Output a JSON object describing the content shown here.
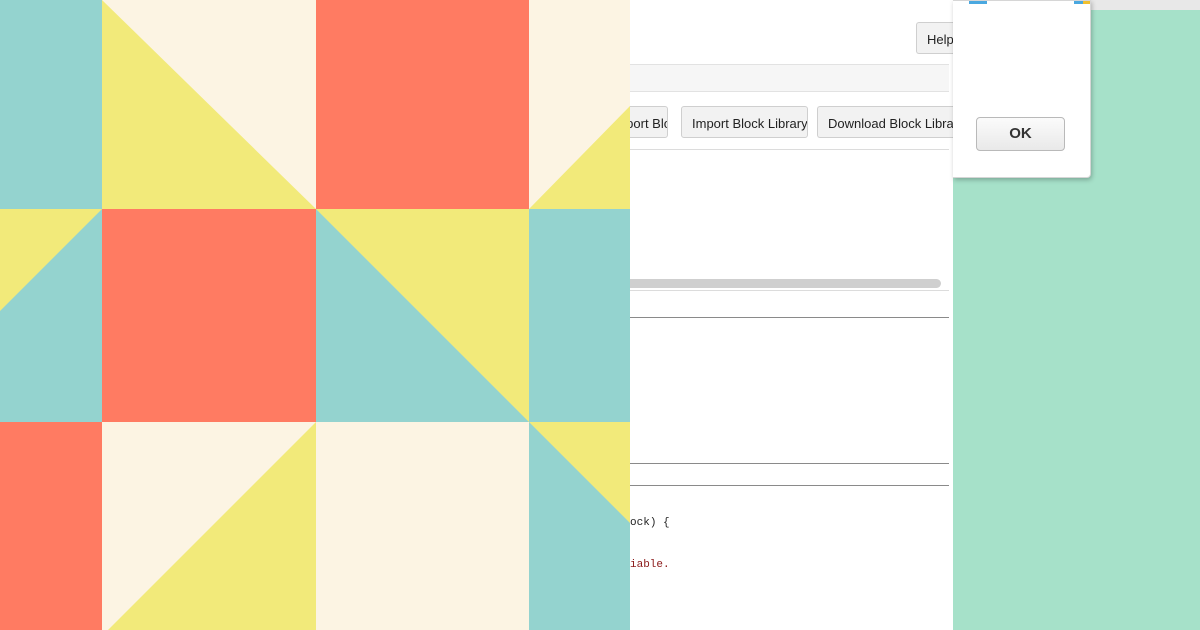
{
  "toolbar": {
    "help_label": "Help",
    "buttons": [
      {
        "label": "Export Block Library"
      },
      {
        "label": "Import Block Library"
      },
      {
        "label": "Download Block Library"
      }
    ]
  },
  "code_preview": {
    "line1_plain": "ock",
    "line1_end": ") {",
    "line2": "iable."
  },
  "dialog": {
    "ok_label": "OK"
  },
  "colors": {
    "teal": "#94d3cf",
    "yellow": "#f2ea7a",
    "cream": "#fcf4e3",
    "coral": "#ff7b62",
    "mint_bg": "#a6e1c9"
  }
}
